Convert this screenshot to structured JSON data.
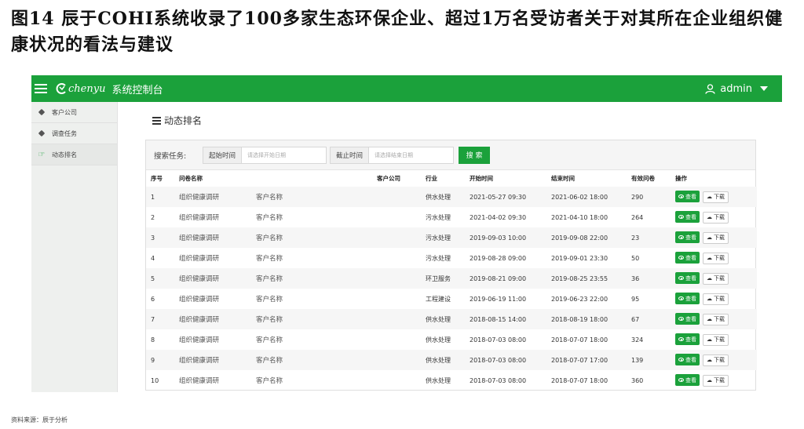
{
  "figure": {
    "caption": "图14   辰于COHI系统收录了100多家生态环保企业、超过1万名受访者关于对其所在企业组织健康状况的看法与建议",
    "source": "资料来源：辰于分析"
  },
  "header": {
    "logo_text": "chenyu",
    "app_title": "系统控制台",
    "user_name": "admin",
    "accent_color": "#1ba13b"
  },
  "sidebar": {
    "items": [
      {
        "label": "客户公司",
        "icon": "tag-icon",
        "active": false
      },
      {
        "label": "调查任务",
        "icon": "tag-icon",
        "active": false
      },
      {
        "label": "动态排名",
        "icon": "hand-pointer-icon",
        "active": true
      }
    ]
  },
  "page": {
    "title": "动态排名",
    "icon": "list-icon"
  },
  "search": {
    "label": "搜索任务:",
    "start_label": "起始时间",
    "start_placeholder": "请选择开始日期",
    "end_label": "截止时间",
    "end_placeholder": "请选择结束日期",
    "button": "搜 索"
  },
  "table": {
    "columns": [
      "序号",
      "问卷名称",
      "客户公司",
      "行业",
      "开始时间",
      "结束时间",
      "有效问卷",
      "操作"
    ],
    "view_label": "查看",
    "download_label": "下载",
    "rows": [
      {
        "no": "1",
        "survey": "组织健康调研",
        "company": "客户名称",
        "industry": "供水处理",
        "start": "2021-05-27 09:30",
        "end": "2021-06-02 18:00",
        "count": "290"
      },
      {
        "no": "2",
        "survey": "组织健康调研",
        "company": "客户名称",
        "industry": "污水处理",
        "start": "2021-04-02 09:30",
        "end": "2021-04-10 18:00",
        "count": "264"
      },
      {
        "no": "3",
        "survey": "组织健康调研",
        "company": "客户名称",
        "industry": "污水处理",
        "start": "2019-09-03 10:00",
        "end": "2019-09-08 22:00",
        "count": "23"
      },
      {
        "no": "4",
        "survey": "组织健康调研",
        "company": "客户名称",
        "industry": "污水处理",
        "start": "2019-08-28 09:00",
        "end": "2019-09-01 23:30",
        "count": "50"
      },
      {
        "no": "5",
        "survey": "组织健康调研",
        "company": "客户名称",
        "industry": "环卫服务",
        "start": "2019-08-21 09:00",
        "end": "2019-08-25 23:55",
        "count": "36"
      },
      {
        "no": "6",
        "survey": "组织健康调研",
        "company": "客户名称",
        "industry": "工程建设",
        "start": "2019-06-19 11:00",
        "end": "2019-06-23 22:00",
        "count": "95"
      },
      {
        "no": "7",
        "survey": "组织健康调研",
        "company": "客户名称",
        "industry": "供水处理",
        "start": "2018-08-15 14:00",
        "end": "2018-08-19 18:00",
        "count": "67"
      },
      {
        "no": "8",
        "survey": "组织健康调研",
        "company": "客户名称",
        "industry": "供水处理",
        "start": "2018-07-03 08:00",
        "end": "2018-07-07 18:00",
        "count": "324"
      },
      {
        "no": "9",
        "survey": "组织健康调研",
        "company": "客户名称",
        "industry": "供水处理",
        "start": "2018-07-03 08:00",
        "end": "2018-07-07 17:00",
        "count": "139"
      },
      {
        "no": "10",
        "survey": "组织健康调研",
        "company": "客户名称",
        "industry": "供水处理",
        "start": "2018-07-03 08:00",
        "end": "2018-07-07 18:00",
        "count": "360"
      }
    ]
  }
}
